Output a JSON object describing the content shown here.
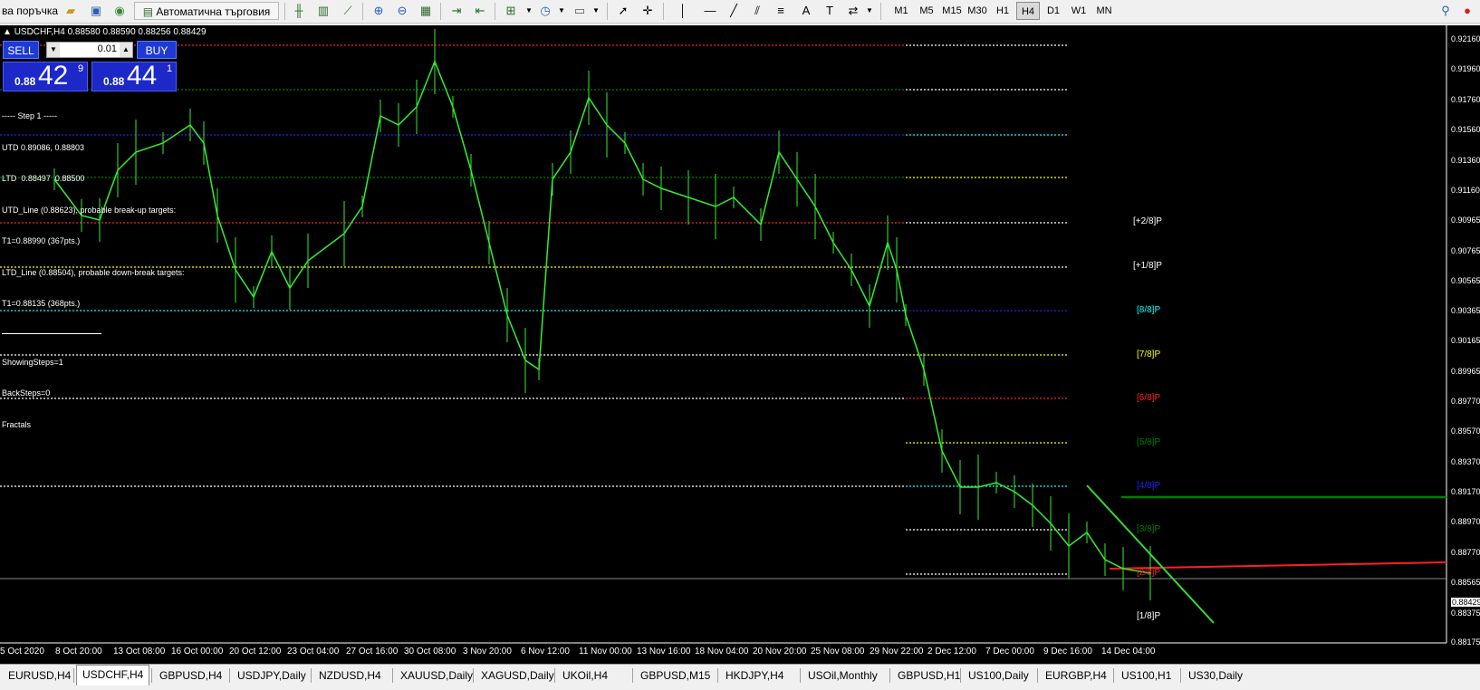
{
  "toolbar": {
    "new_order_label": "ва поръчка",
    "autotrading_label": "Автоматична търговия",
    "timeframes": [
      {
        "label": "M1",
        "active": false
      },
      {
        "label": "M5",
        "active": false
      },
      {
        "label": "M15",
        "active": false
      },
      {
        "label": "M30",
        "active": false
      },
      {
        "label": "H1",
        "active": false
      },
      {
        "label": "H4",
        "active": true
      },
      {
        "label": "D1",
        "active": false
      },
      {
        "label": "W1",
        "active": false
      },
      {
        "label": "MN",
        "active": false
      }
    ]
  },
  "chart": {
    "symbol_header": "USDCHF,H4  0.88580 0.88590 0.88256 0.88429",
    "trade_panel": {
      "sell_label": "SELL",
      "buy_label": "BUY",
      "lot_value": "0.01",
      "bid_prefix": "0.88",
      "bid_big": "42",
      "bid_sup": "9",
      "ask_prefix": "0.88",
      "ask_big": "44",
      "ask_sup": "1"
    },
    "info_lines": [
      "----- Step 1 -----",
      "UTD 0.89086, 0.88803",
      "LTD  0.88497  0.88500",
      "UTD_Line (0.88623), probable break-up targets:",
      "T1=0.88990 (367pts.)",
      "LTD_Line (0.88504), probable down-break targets:",
      "T1=0.88135 (368pts.)"
    ],
    "info_lines_2": [
      "ShowingSteps=1",
      "BackSteps=0",
      "Fractals"
    ],
    "price_axis": [
      "0.92160",
      "0.91960",
      "0.91760",
      "0.91560",
      "0.91360",
      "0.91160",
      "0.90965",
      "0.90765",
      "0.90565",
      "0.90365",
      "0.90165",
      "0.89965",
      "0.89770",
      "0.89570",
      "0.89370",
      "0.89170",
      "0.88970",
      "0.88770",
      "0.88565",
      "0.88375",
      "0.88175"
    ],
    "current_price": "0.88429",
    "time_axis": [
      "5 Oct 2020",
      "8 Oct 20:00",
      "13 Oct 08:00",
      "16 Oct 00:00",
      "20 Oct 12:00",
      "23 Oct 04:00",
      "27 Oct 16:00",
      "30 Oct 08:00",
      "3 Nov 20:00",
      "6 Nov 12:00",
      "11 Nov 00:00",
      "13 Nov 16:00",
      "18 Nov 04:00",
      "20 Nov 20:00",
      "25 Nov 08:00",
      "29 Nov 22:00",
      "2 Dec 12:00",
      "7 Dec 00:00",
      "9 Dec 16:00",
      "14 Dec 04:00"
    ],
    "murrey_labels": [
      {
        "text": "[+2/8]P",
        "color": "#ffffff"
      },
      {
        "text": "[+1/8]P",
        "color": "#ffffff"
      },
      {
        "text": "[8/8]P",
        "color": "#00ffff"
      },
      {
        "text": "[7/8]P",
        "color": "#ffff00"
      },
      {
        "text": "[6/8]P",
        "color": "#ff2020"
      },
      {
        "text": "[5/8]P",
        "color": "#008000"
      },
      {
        "text": "[4/8]P",
        "color": "#2020ff"
      },
      {
        "text": "[3/8]P",
        "color": "#008000"
      },
      {
        "text": "[2/8]P",
        "color": "#ff2020"
      },
      {
        "text": "[1/8]P",
        "color": "#ffffff"
      }
    ]
  },
  "tabs": [
    {
      "label": "EURUSD,H4",
      "active": false
    },
    {
      "label": "USDCHF,H4",
      "active": true
    },
    {
      "label": "GBPUSD,H4",
      "active": false
    },
    {
      "label": "USDJPY,Daily",
      "active": false
    },
    {
      "label": "NZDUSD,H4",
      "active": false
    },
    {
      "label": "XAUUSD,Daily",
      "active": false
    },
    {
      "label": "XAGUSD,Daily",
      "active": false
    },
    {
      "label": "UKOil,H4",
      "active": false
    },
    {
      "label": "GBPUSD,M15",
      "active": false
    },
    {
      "label": "HKDJPY,H4",
      "active": false
    },
    {
      "label": "USOil,Monthly",
      "active": false
    },
    {
      "label": "GBPUSD,H1",
      "active": false
    },
    {
      "label": "US100,Daily",
      "active": false
    },
    {
      "label": "EURGBP,H4",
      "active": false
    },
    {
      "label": "US100,H1",
      "active": false
    },
    {
      "label": "US30,Daily",
      "active": false
    }
  ]
}
